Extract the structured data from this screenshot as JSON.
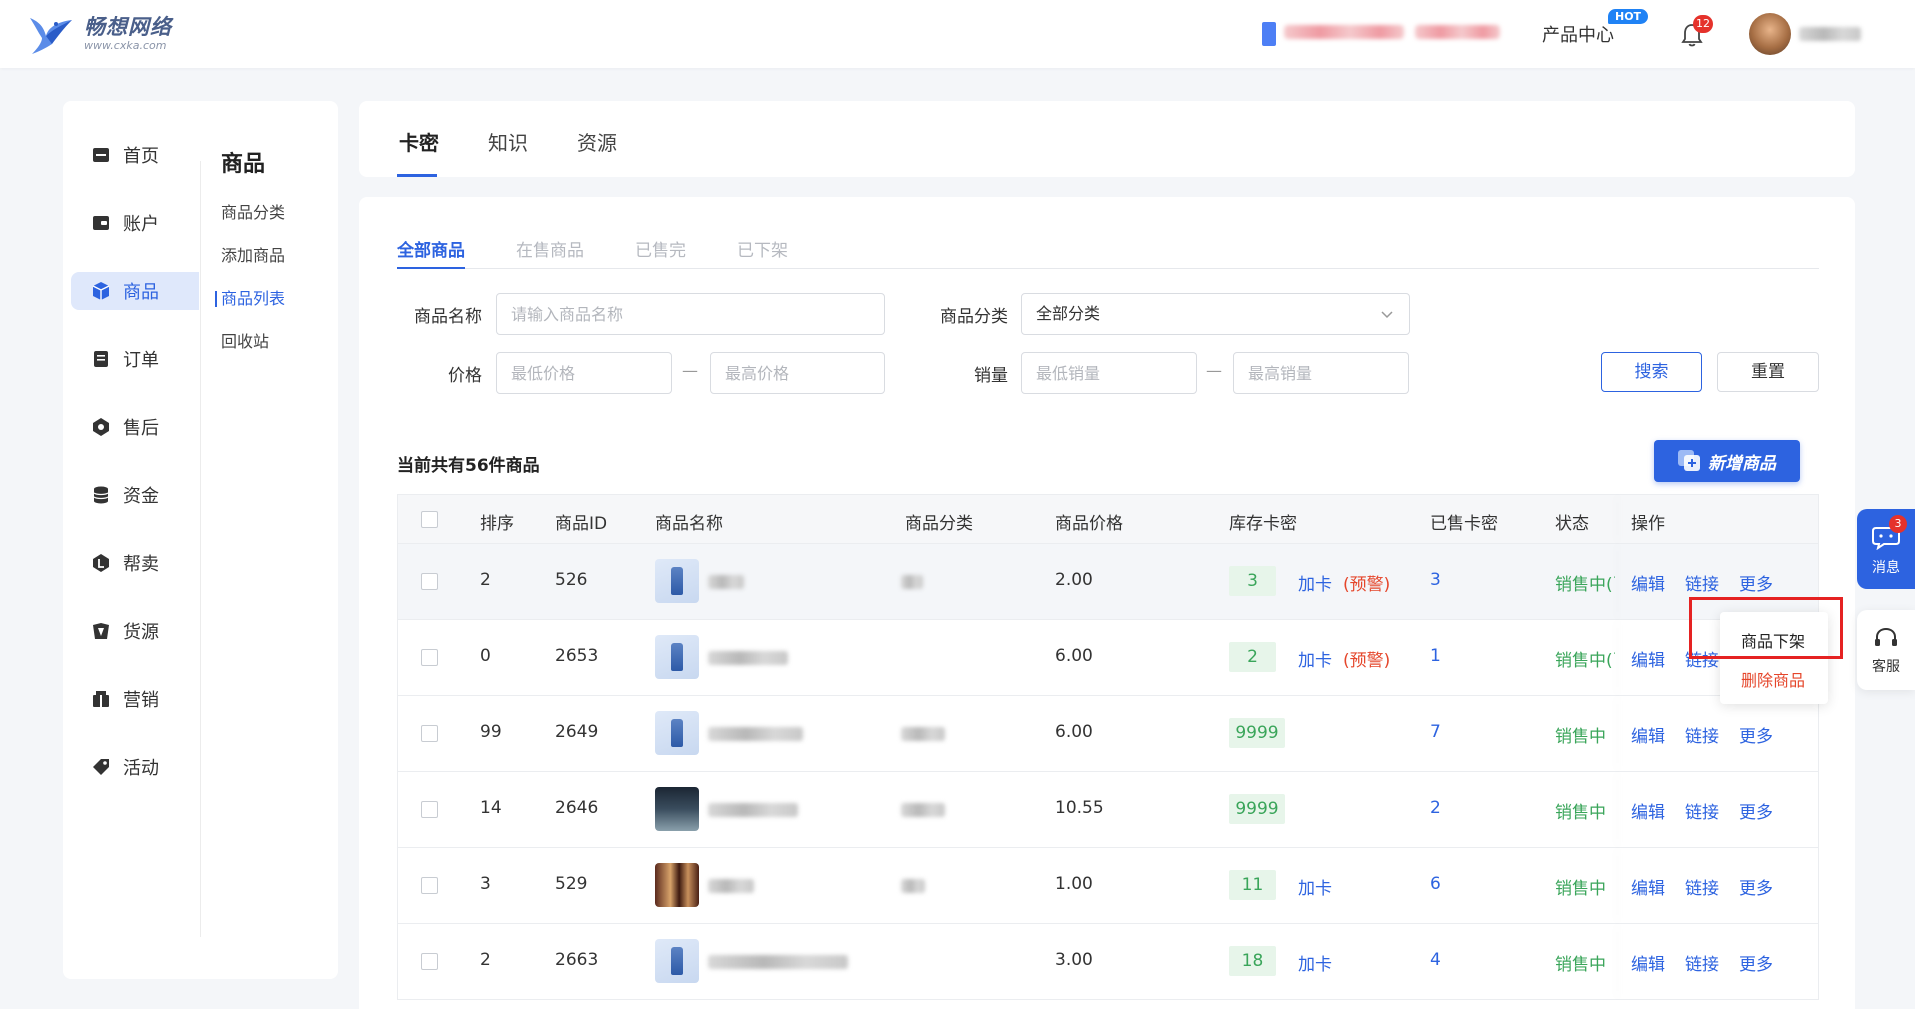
{
  "header": {
    "brand_name": "畅想网络",
    "brand_url": "www.cxka.com",
    "product_center": "产品中心",
    "hot_label": "HOT",
    "notification_count": "12"
  },
  "sidebar": {
    "items": [
      {
        "label": "首页",
        "icon": "home-icon"
      },
      {
        "label": "账户",
        "icon": "wallet-icon"
      },
      {
        "label": "商品",
        "icon": "cube-icon"
      },
      {
        "label": "订单",
        "icon": "order-icon"
      },
      {
        "label": "售后",
        "icon": "aftersale-icon"
      },
      {
        "label": "资金",
        "icon": "coins-icon"
      },
      {
        "label": "帮卖",
        "icon": "share-icon"
      },
      {
        "label": "货源",
        "icon": "supply-icon"
      },
      {
        "label": "营销",
        "icon": "marketing-icon"
      },
      {
        "label": "活动",
        "icon": "tag-icon"
      }
    ],
    "active_index": 2
  },
  "submenu": {
    "title": "商品",
    "items": [
      "商品分类",
      "添加商品",
      "商品列表",
      "回收站"
    ],
    "active_index": 2
  },
  "top_tabs": [
    "卡密",
    "知识",
    "资源"
  ],
  "sub_tabs": [
    "全部商品",
    "在售商品",
    "已售完",
    "已下架"
  ],
  "filters": {
    "name_label": "商品名称",
    "name_placeholder": "请输入商品名称",
    "category_label": "商品分类",
    "category_value": "全部分类",
    "price_label": "价格",
    "price_min_placeholder": "最低价格",
    "price_max_placeholder": "最高价格",
    "sales_label": "销量",
    "sales_min_placeholder": "最低销量",
    "sales_max_placeholder": "最高销量",
    "search_button": "搜索",
    "reset_button": "重置",
    "dash": "—"
  },
  "summary": "当前共有56件商品",
  "add_button": "新增商品",
  "table": {
    "columns": [
      "排序",
      "商品ID",
      "商品名称",
      "商品分类",
      "商品价格",
      "库存卡密",
      "已售卡密",
      "状态",
      "操作"
    ],
    "rows": [
      {
        "sort": "2",
        "id": "526",
        "price": "2.00",
        "stock": "3",
        "add": "加卡",
        "warn": "(预警)",
        "sold": "3",
        "status": "销售中(已",
        "thumb": "bottle"
      },
      {
        "sort": "0",
        "id": "2653",
        "price": "6.00",
        "stock": "2",
        "add": "加卡",
        "warn": "(预警)",
        "sold": "1",
        "status": "销售中(已",
        "thumb": "bottle"
      },
      {
        "sort": "99",
        "id": "2649",
        "price": "6.00",
        "stock": "9999",
        "add": "",
        "warn": "",
        "sold": "7",
        "status": "销售中",
        "thumb": "bottle"
      },
      {
        "sort": "14",
        "id": "2646",
        "price": "10.55",
        "stock": "9999",
        "add": "",
        "warn": "",
        "sold": "2",
        "status": "销售中",
        "thumb": "night"
      },
      {
        "sort": "3",
        "id": "529",
        "price": "1.00",
        "stock": "11",
        "add": "加卡",
        "warn": "",
        "sold": "6",
        "status": "销售中",
        "thumb": "people"
      },
      {
        "sort": "2",
        "id": "2663",
        "price": "3.00",
        "stock": "18",
        "add": "加卡",
        "warn": "",
        "sold": "4",
        "status": "销售中",
        "thumb": "bottle"
      }
    ],
    "op_edit": "编辑",
    "op_link": "链接",
    "op_more": "更多"
  },
  "more_menu": {
    "item1": "商品下架",
    "item2": "删除商品"
  },
  "float": {
    "message_label": "消息",
    "message_count": "3",
    "service_label": "客服"
  },
  "colors": {
    "accent": "#2d63e0",
    "success": "#3aa55a",
    "danger": "#e5462b"
  }
}
